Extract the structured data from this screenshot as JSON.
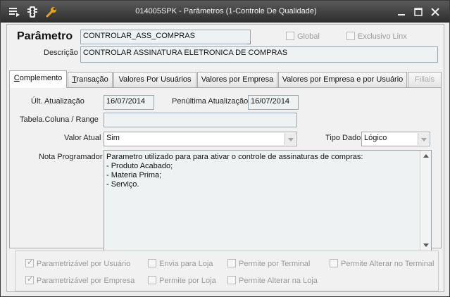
{
  "window": {
    "title": "014005SPK - Parâmetros (1-Controle De Qualidade)",
    "toolbar_icons": [
      "menu-icon",
      "traffic-light-icon",
      "wrench-icon"
    ],
    "window_buttons": [
      "minimize-icon",
      "maximize-icon",
      "close-icon"
    ]
  },
  "header": {
    "parametro_label": "Parâmetro",
    "parametro_value": "CONTROLAR_ASS_COMPRAS",
    "descricao_label": "Descrição",
    "descricao_value": "CONTROLAR ASSINATURA ELETRONICA DE COMPRAS",
    "global_label": "Global",
    "global_checked": false,
    "exclusivo_label": "Exclusivo Linx",
    "exclusivo_checked": false
  },
  "tabs": [
    {
      "label": "Complemento",
      "underline": "C",
      "rest": "omplemento",
      "active": true,
      "disabled": false
    },
    {
      "label": "Transação",
      "underline": "T",
      "rest": "ransação",
      "active": false,
      "disabled": false
    },
    {
      "label": "Valores Por Usuários",
      "active": false,
      "disabled": false
    },
    {
      "label": "Valores por Empresa",
      "active": false,
      "disabled": false
    },
    {
      "label": "Valores por Empresa e por Usuário",
      "active": false,
      "disabled": false
    },
    {
      "label": "Filiais",
      "active": false,
      "disabled": true
    }
  ],
  "complemento": {
    "ult_atualizacao_label": "Últ. Atualização",
    "ult_atualizacao_value": "16/07/2014",
    "penultima_label": "Penúltima Atualização",
    "penultima_value": "16/07/2014",
    "tabela_label": "Tabela.Coluna / Range",
    "tabela_value": "",
    "valor_atual_label": "Valor Atual",
    "valor_atual_value": "Sim",
    "tipo_dado_label": "Tipo Dado",
    "tipo_dado_value": "Lógico",
    "nota_label": "Nota Programador",
    "nota_value": "Parametro utilizado para para ativar o controle de assinaturas de compras:\n- Produto Acabado;\n- Materia Prima;\n- Serviço."
  },
  "options": {
    "parametrizavel_usuario": {
      "label": "Parametrizável por Usuário",
      "checked": true
    },
    "envia_loja": {
      "label": "Envia para Loja",
      "checked": false
    },
    "permite_terminal": {
      "label": "Permite por Terminal",
      "checked": false
    },
    "permite_alterar_terminal": {
      "label": "Permite Alterar no Terminal",
      "checked": false
    },
    "parametrizavel_empresa": {
      "label": "Parametrizável por Empresa",
      "checked": true
    },
    "permite_loja": {
      "label": "Permite por Loja",
      "checked": false
    },
    "permite_alterar_loja": {
      "label": "Permite Alterar na Loja",
      "checked": false
    }
  }
}
